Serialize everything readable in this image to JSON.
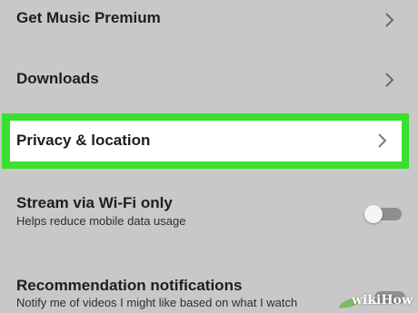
{
  "settings": {
    "items": [
      {
        "label": "Get Music Premium"
      },
      {
        "label": "Downloads"
      },
      {
        "label": "Privacy & location"
      },
      {
        "label": "Stream via Wi-Fi only",
        "description": "Helps reduce mobile data usage",
        "enabled": false
      },
      {
        "label": "Recommendation notifications",
        "description": "Notify me of videos I might like based on what I watch",
        "enabled": false
      }
    ]
  },
  "highlight_color": "#39e030",
  "icons": {
    "chevron": "chevron-right-icon",
    "toggle": "toggle-switch"
  },
  "watermark": {
    "text": "wikiHow"
  }
}
